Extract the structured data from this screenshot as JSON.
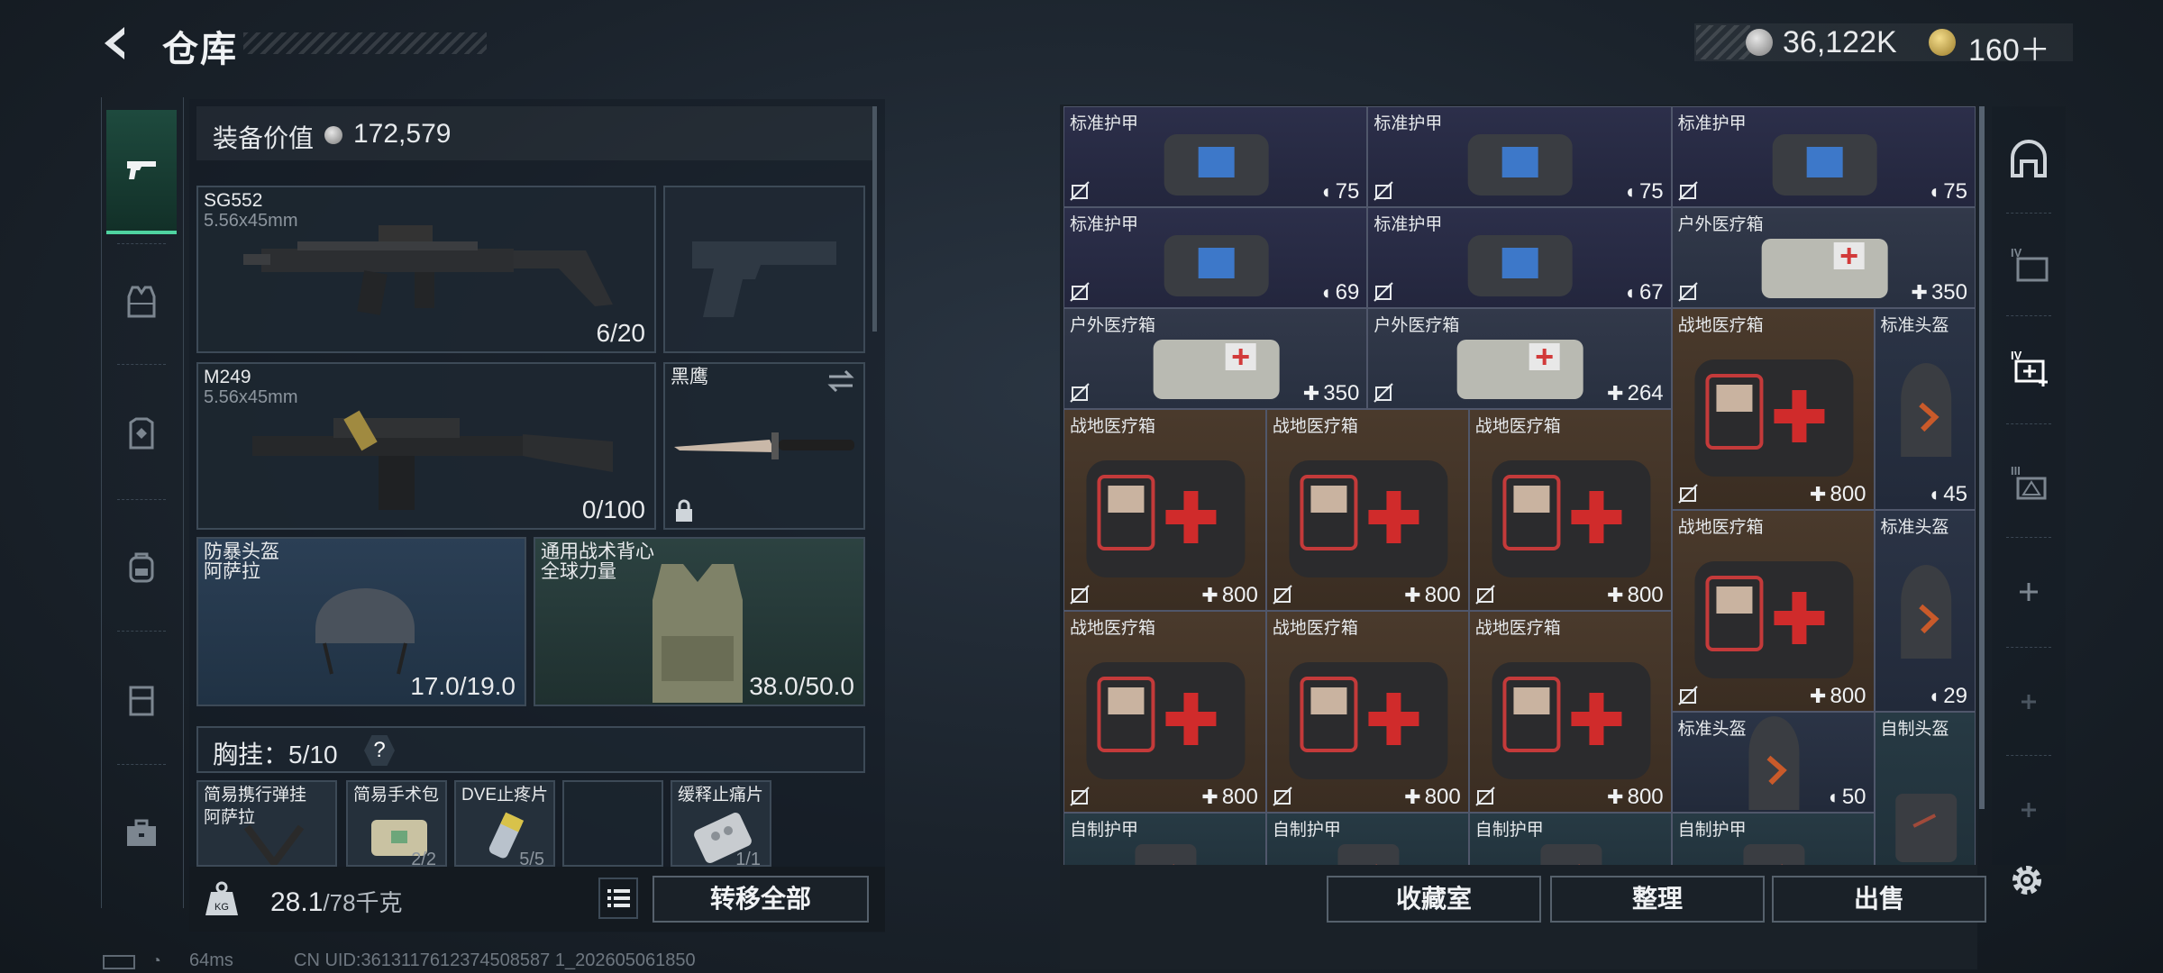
{
  "header": {
    "title": "仓库",
    "money": "36,122K",
    "gold": "160＋"
  },
  "footer": {
    "ping": "64ms",
    "uid": "CN UID:3613117612374508587 1_202605061850"
  },
  "left_panel": {
    "equip_value_label": "装备价值",
    "equip_value": "172,579",
    "primary": {
      "name": "SG552",
      "caliber": "5.56x45mm",
      "ammo": "6/20"
    },
    "secondary": {
      "name": "M249",
      "caliber": "5.56x45mm",
      "ammo": "0/100"
    },
    "melee": {
      "name": "黑鹰"
    },
    "helmet": {
      "name": "防暴头盔",
      "sub": "阿萨拉",
      "durability": "17.0/19.0"
    },
    "vest": {
      "name": "通用战术背心",
      "sub": "全球力量",
      "durability": "38.0/50.0"
    },
    "chest_label": "胸挂：",
    "chest_count": "5/10",
    "help": "?",
    "chest_items": [
      {
        "name": "简易携行弹挂",
        "sub": "阿萨拉"
      },
      {
        "name": "简易手术包",
        "count": "2/2"
      },
      {
        "name": "DVE止疼片",
        "count": "5/5"
      },
      {
        "name": ""
      },
      {
        "name": "缓释止痛片",
        "count": "1/1"
      }
    ],
    "weight": "28.1",
    "weight_cap": "/78千克",
    "transfer_all": "转移全部"
  },
  "grid": {
    "cells": [
      {
        "name": "标准护甲",
        "value": "75",
        "kind": "armor"
      },
      {
        "name": "标准护甲",
        "value": "75",
        "kind": "armor"
      },
      {
        "name": "标准护甲",
        "value": "75",
        "kind": "armor"
      },
      {
        "name": "标准护甲",
        "value": "69",
        "kind": "armor"
      },
      {
        "name": "标准护甲",
        "value": "67",
        "kind": "armor"
      },
      {
        "name": "户外医疗箱",
        "value": "350",
        "kind": "med"
      },
      {
        "name": "户外医疗箱",
        "value": "350",
        "kind": "med"
      },
      {
        "name": "户外医疗箱",
        "value": "264",
        "kind": "med"
      },
      {
        "name": "战地医疗箱",
        "value": "800",
        "kind": "field"
      },
      {
        "name": "标准头盔",
        "value": "45",
        "kind": "helm"
      },
      {
        "name": "战地医疗箱",
        "value": "800",
        "kind": "field"
      },
      {
        "name": "战地医疗箱",
        "value": "800",
        "kind": "field"
      },
      {
        "name": "战地医疗箱",
        "value": "800",
        "kind": "field"
      },
      {
        "name": "战地医疗箱",
        "value": "800",
        "kind": "field"
      },
      {
        "name": "标准头盔",
        "value": "29",
        "kind": "helm"
      },
      {
        "name": "战地医疗箱",
        "value": "800",
        "kind": "field"
      },
      {
        "name": "战地医疗箱",
        "value": "800",
        "kind": "field"
      },
      {
        "name": "战地医疗箱",
        "value": "800",
        "kind": "field"
      },
      {
        "name": "标准头盔",
        "value": "50",
        "kind": "helm"
      },
      {
        "name": "自制头盔",
        "value": "",
        "kind": "self"
      },
      {
        "name": "自制护甲",
        "value": "",
        "kind": "self"
      },
      {
        "name": "自制护甲",
        "value": "",
        "kind": "self"
      },
      {
        "name": "自制护甲",
        "value": "",
        "kind": "self"
      },
      {
        "name": "自制护甲",
        "value": "",
        "kind": "self"
      }
    ]
  },
  "buttons": {
    "collection": "收藏室",
    "sort": "整理",
    "sell": "出售"
  },
  "right_tabs": {
    "tab_iv": "IV",
    "tab_iv2": "IV",
    "tab_iii": "III",
    "plus": "+"
  },
  "colors": {
    "accent_green": "#4fd3a0",
    "armor_cell": "#2c2f4a",
    "field_med_cell": "#4a3a2c"
  }
}
